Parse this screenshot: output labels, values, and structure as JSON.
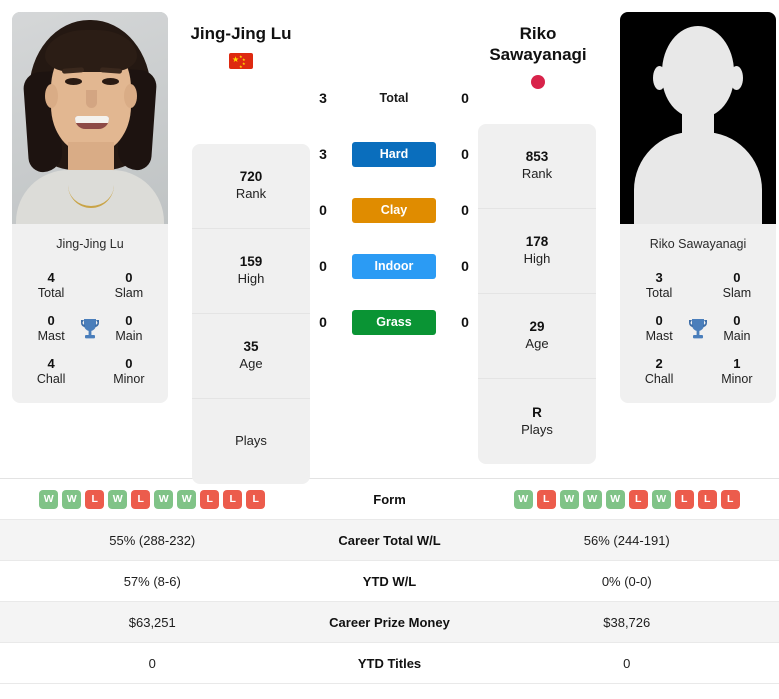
{
  "players": {
    "left": {
      "name": "Jing-Jing Lu",
      "name_under_photo": "Jing-Jing Lu",
      "country_icon": "flag-china-icon",
      "rank": "720",
      "rank_label": "Rank",
      "high": "159",
      "high_label": "High",
      "age": "35",
      "age_label": "Age",
      "plays": "",
      "plays_label": "Plays",
      "titles": {
        "total": "4",
        "total_label": "Total",
        "slam": "0",
        "slam_label": "Slam",
        "mast": "0",
        "mast_label": "Mast",
        "main": "0",
        "main_label": "Main",
        "chall": "4",
        "chall_label": "Chall",
        "minor": "0",
        "minor_label": "Minor"
      },
      "form": [
        "W",
        "W",
        "L",
        "W",
        "L",
        "W",
        "W",
        "L",
        "L",
        "L"
      ],
      "career_total_wl": "55% (288-232)",
      "ytd_wl": "57% (8-6)",
      "career_prize_money": "$63,251",
      "ytd_titles": "0"
    },
    "right": {
      "name": "Riko Sawayanagi",
      "name_under_photo": "Riko Sawayanagi",
      "country_icon": "flag-japan-icon",
      "rank": "853",
      "rank_label": "Rank",
      "high": "178",
      "high_label": "High",
      "age": "29",
      "age_label": "Age",
      "plays": "R",
      "plays_label": "Plays",
      "titles": {
        "total": "3",
        "total_label": "Total",
        "slam": "0",
        "slam_label": "Slam",
        "mast": "0",
        "mast_label": "Mast",
        "main": "0",
        "main_label": "Main",
        "chall": "2",
        "chall_label": "Chall",
        "minor": "1",
        "minor_label": "Minor"
      },
      "form": [
        "W",
        "L",
        "W",
        "W",
        "W",
        "L",
        "W",
        "L",
        "L",
        "L"
      ],
      "career_total_wl": "56% (244-191)",
      "ytd_wl": "0% (0-0)",
      "career_prize_money": "$38,726",
      "ytd_titles": "0"
    }
  },
  "surfaces": [
    {
      "label": "Total",
      "left": "3",
      "right": "0",
      "style": "plain",
      "color": ""
    },
    {
      "label": "Hard",
      "left": "3",
      "right": "0",
      "style": "hard",
      "color": "#0a6ebd"
    },
    {
      "label": "Clay",
      "left": "0",
      "right": "0",
      "style": "clay",
      "color": "#e08c00"
    },
    {
      "label": "Indoor",
      "left": "0",
      "right": "0",
      "style": "indoor",
      "color": "#2b9bf4"
    },
    {
      "label": "Grass",
      "left": "0",
      "right": "0",
      "style": "grass",
      "color": "#0a9434"
    }
  ],
  "table": {
    "rows": [
      {
        "label": "Form",
        "type": "form"
      },
      {
        "label": "Career Total W/L",
        "type": "text",
        "key": "career_total_wl"
      },
      {
        "label": "YTD W/L",
        "type": "text",
        "key": "ytd_wl"
      },
      {
        "label": "Career Prize Money",
        "type": "text",
        "key": "career_prize_money"
      },
      {
        "label": "YTD Titles",
        "type": "text",
        "key": "ytd_titles"
      }
    ]
  },
  "colors": {
    "win_badge": "#80c387",
    "loss_badge": "#ec5c4c",
    "card_bg": "#f0f0f0",
    "row_alt": "#f4f4f4",
    "trophy": "#4a7ebb"
  }
}
